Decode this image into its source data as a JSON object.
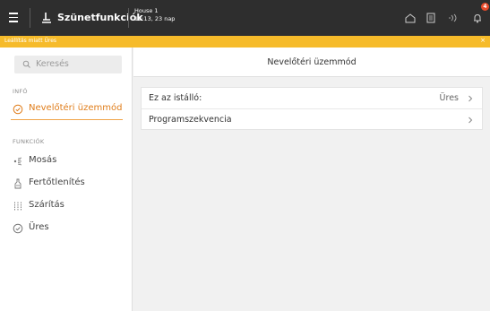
{
  "topbar": {
    "app_title": "Szünetfunkciók",
    "house_name": "House 1",
    "house_datetime": "12:13, 23 nap",
    "badge_count": "4",
    "icons": [
      "menu-icon",
      "cow-icon",
      "home-icon",
      "document-icon",
      "signal-icon",
      "bell-icon"
    ]
  },
  "notice": {
    "text": "Leállítás miatt Üres",
    "close": "×",
    "color": "#f6bb2a"
  },
  "sidebar": {
    "search_placeholder": "Keresés",
    "info_label": "INFÓ",
    "info_items": [
      {
        "label": "Nevelőtéri üzemmód",
        "icon": "circle-check-icon",
        "active": true
      }
    ],
    "functions_label": "FUNKCIÓK",
    "function_items": [
      {
        "label": "Mosás",
        "icon": "spray-icon"
      },
      {
        "label": "Fertőtlenítés",
        "icon": "disinfect-icon"
      },
      {
        "label": "Szárítás",
        "icon": "dry-icon"
      },
      {
        "label": "Üres",
        "icon": "circle-check-icon"
      }
    ]
  },
  "main": {
    "title": "Nevelőtéri üzemmód",
    "rows": [
      {
        "label": "Ez az istálló:",
        "value": "Üres"
      },
      {
        "label": "Programszekvencia",
        "value": ""
      }
    ]
  },
  "colors": {
    "topbar": "#2e2e2e",
    "accent": "#e07d1a",
    "badge": "#e84a2a"
  }
}
